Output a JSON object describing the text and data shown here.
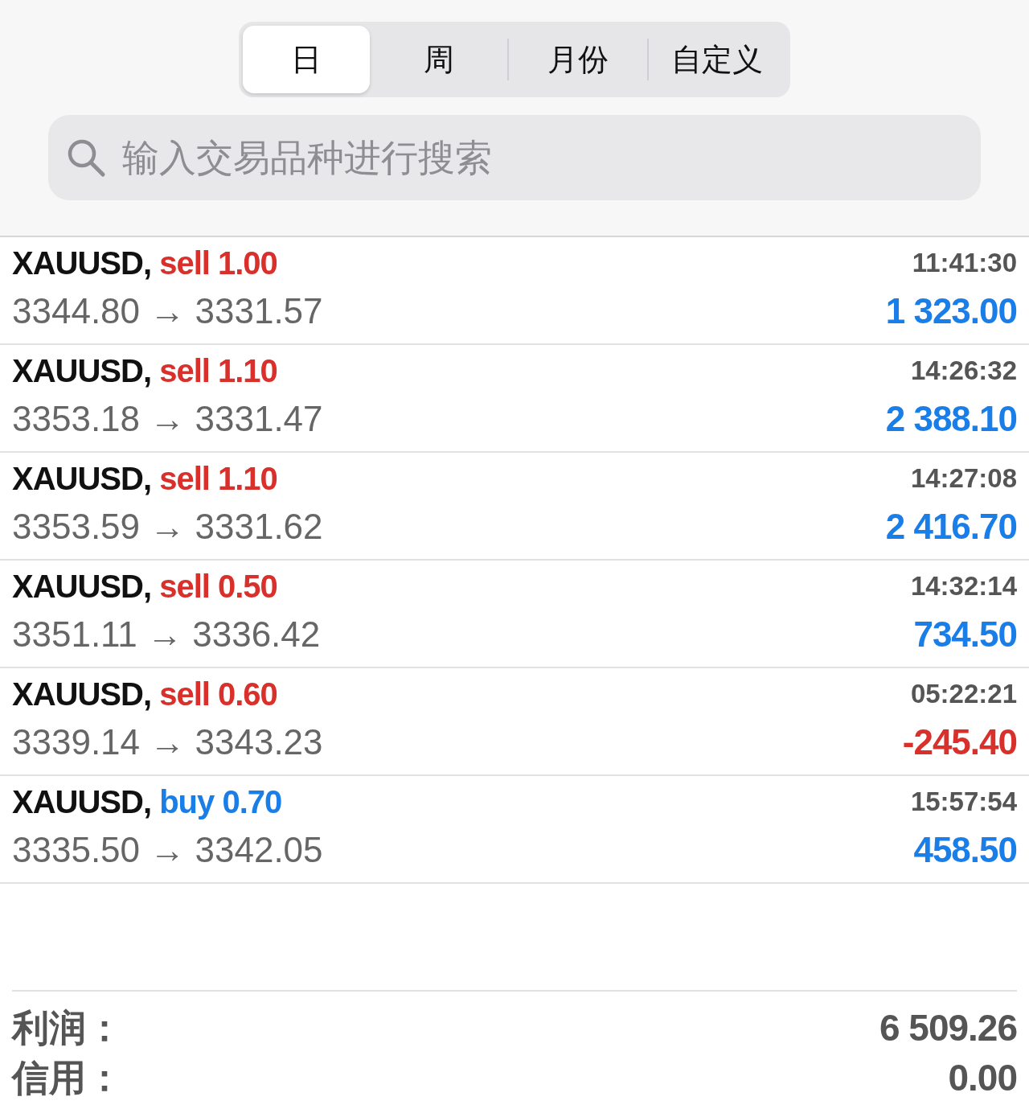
{
  "tabs": [
    {
      "label": "日",
      "selected": true
    },
    {
      "label": "周",
      "selected": false
    },
    {
      "label": "月份",
      "selected": false
    },
    {
      "label": "自定义",
      "selected": false
    }
  ],
  "search": {
    "placeholder": "输入交易品种进行搜索"
  },
  "trades": [
    {
      "symbol": "XAUUSD,",
      "side": "sell",
      "volume": "1.00",
      "open_price": "3344.80",
      "arrow": "→",
      "close_price": "3331.57",
      "time": "11:41:30",
      "profit": "1 323.00",
      "loss": false
    },
    {
      "symbol": "XAUUSD,",
      "side": "sell",
      "volume": "1.10",
      "open_price": "3353.18",
      "arrow": "→",
      "close_price": "3331.47",
      "time": "14:26:32",
      "profit": "2 388.10",
      "loss": false
    },
    {
      "symbol": "XAUUSD,",
      "side": "sell",
      "volume": "1.10",
      "open_price": "3353.59",
      "arrow": "→",
      "close_price": "3331.62",
      "time": "14:27:08",
      "profit": "2 416.70",
      "loss": false
    },
    {
      "symbol": "XAUUSD,",
      "side": "sell",
      "volume": "0.50",
      "open_price": "3351.11",
      "arrow": "→",
      "close_price": "3336.42",
      "time": "14:32:14",
      "profit": "734.50",
      "loss": false
    },
    {
      "symbol": "XAUUSD,",
      "side": "sell",
      "volume": "0.60",
      "open_price": "3339.14",
      "arrow": "→",
      "close_price": "3343.23",
      "time": "05:22:21",
      "profit": "-245.40",
      "loss": true
    },
    {
      "symbol": "XAUUSD,",
      "side": "buy",
      "volume": "0.70",
      "open_price": "3335.50",
      "arrow": "→",
      "close_price": "3342.05",
      "time": "15:57:54",
      "profit": "458.50",
      "loss": false
    }
  ],
  "summary": [
    {
      "label": "利润：",
      "value": "6 509.26"
    },
    {
      "label": "信用：",
      "value": "0.00"
    }
  ]
}
